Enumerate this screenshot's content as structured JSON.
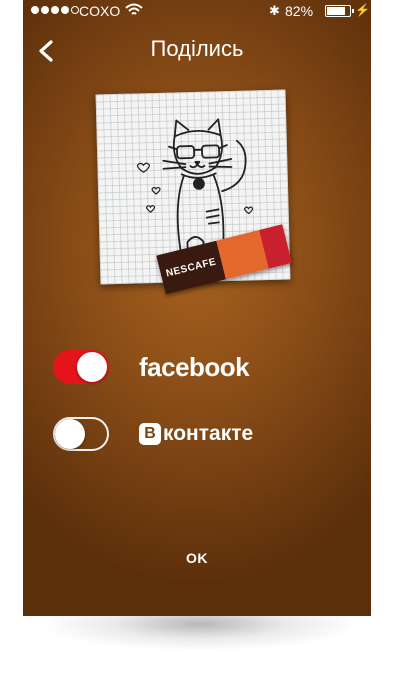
{
  "statusbar": {
    "carrier": "COXO",
    "battery_percent": "82%",
    "battery_level": 0.82,
    "signal_bars": 4,
    "signal_total": 5,
    "icons": [
      "signal-dots-icon",
      "wifi-icon",
      "bluetooth-icon",
      "battery-icon",
      "charging-bolt-icon"
    ]
  },
  "nav": {
    "back_icon": "chevron-left-icon",
    "title": "Поділись"
  },
  "photo": {
    "sachet_brand": "NESCAFE"
  },
  "share": {
    "facebook": {
      "label": "facebook",
      "enabled": true
    },
    "vkontakte": {
      "label": "контакте",
      "logo_letter": "B",
      "enabled": false
    }
  },
  "actions": {
    "ok_label": "OK"
  },
  "colors": {
    "background": "#8a4d17",
    "toggle_on": "#e3151b",
    "text": "#ffffff"
  }
}
